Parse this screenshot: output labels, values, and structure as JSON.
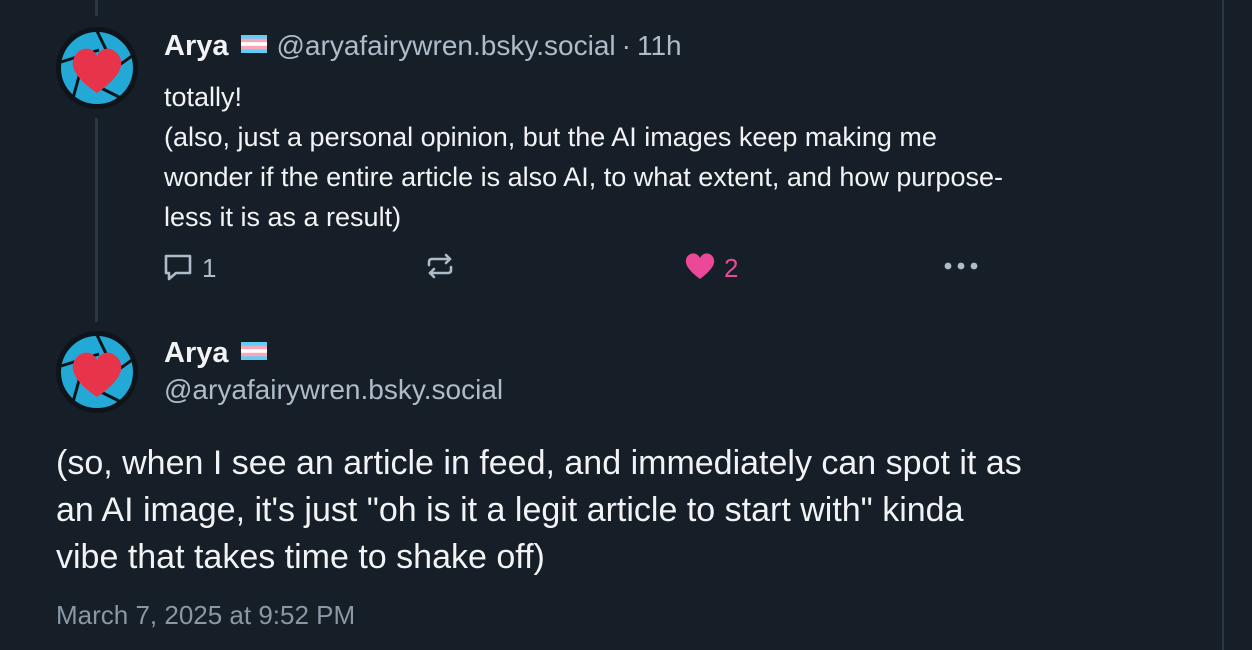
{
  "reply_post": {
    "author_name": "Arya",
    "handle": "@aryafairywren.bsky.social",
    "separator": "·",
    "time_ago": "11h",
    "text_lines": [
      "totally!",
      "(also, just a personal opinion, but the AI images keep making me",
      "wonder if the entire article is also AI, to what extent, and how purpose-",
      "less it is as a result)"
    ],
    "reply_count": "1",
    "like_count": "2",
    "liked": true
  },
  "main_post": {
    "author_name": "Arya",
    "handle": "@aryafairywren.bsky.social",
    "text_lines": [
      "(so, when I see an article in feed, and immediately can spot it as",
      "an AI image, it's just \"oh is it a legit article to start with\" kinda",
      "vibe that takes time to shake off)"
    ],
    "timestamp": "March 7, 2025 at 9:52 PM"
  },
  "icons": {
    "reply": "speech-bubble-icon",
    "repost": "repost-arrows-icon",
    "like": "heart-icon",
    "more": "ellipsis-icon",
    "flag": "transgender-flag-icon"
  },
  "colors": {
    "background": "#161e27",
    "text": "#f1f3f5",
    "muted": "#aebbc9",
    "like": "#ec4899",
    "avatar_ring": "#22a9d6",
    "avatar_heart": "#e8344a"
  }
}
